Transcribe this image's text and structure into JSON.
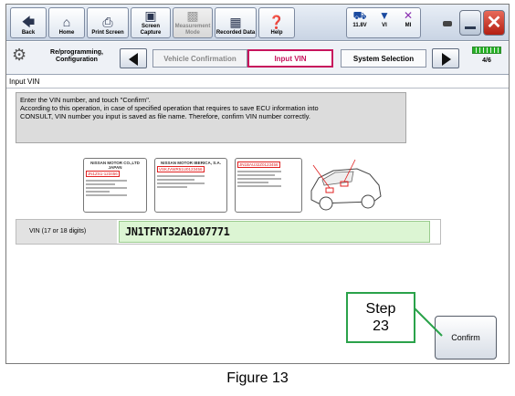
{
  "toolbar": {
    "buttons": [
      {
        "label": "Back",
        "icon": "back-arrow-icon"
      },
      {
        "label": "Home",
        "icon": "home-icon"
      },
      {
        "label": "Print Screen",
        "icon": "printer-icon"
      },
      {
        "label": "Screen Capture",
        "icon": "camera-icon"
      },
      {
        "label": "Measurement Mode",
        "icon": "meter-icon"
      },
      {
        "label": "Recorded Data",
        "icon": "recorded-data-icon"
      },
      {
        "label": "Help",
        "icon": "help-icon"
      }
    ],
    "status": {
      "battery": "11.8V",
      "vi": "VI",
      "mi": "MI"
    }
  },
  "nav": {
    "section_label": "Re/programming, Configuration",
    "steps": [
      "Vehicle Confirmation",
      "Input VIN",
      "System Selection"
    ],
    "active_step": "Input VIN",
    "progress": "4/6",
    "progress_fraction": 0.67
  },
  "page": {
    "title": "Input VIN",
    "instructions": [
      "Enter the VIN number, and touch \"Confirm\".",
      "According to this operation, in case of specified operation that requires to save ECU information into",
      "CONSULT, VIN number you input is saved as file name. Therefore, confirm VIN number correctly."
    ],
    "vin_label": "VIN (17 or 18 digits)",
    "vin_value": "JN1TFNT32A0107771",
    "confirm_label": "Confirm"
  },
  "illustration": {
    "plate1": {
      "header": "NISSAN MOTOR CO.,LTD JAPAN",
      "vin": "JN1ZS1-123456"
    },
    "plate2": {
      "header": "NISSAN MOTOR IBERICA, S.A.",
      "vin": "VSKJVWR51U0123456"
    },
    "plate3": {
      "vin": "JN1BAU32Z0123456"
    }
  },
  "callout": {
    "line1": "Step",
    "line2": "23"
  },
  "caption": "Figure 13",
  "colors": {
    "accent_active": "#c7145c",
    "callout_border": "#2aa24a",
    "vin_field": "#dcf5d3",
    "close": "#c0392b"
  }
}
